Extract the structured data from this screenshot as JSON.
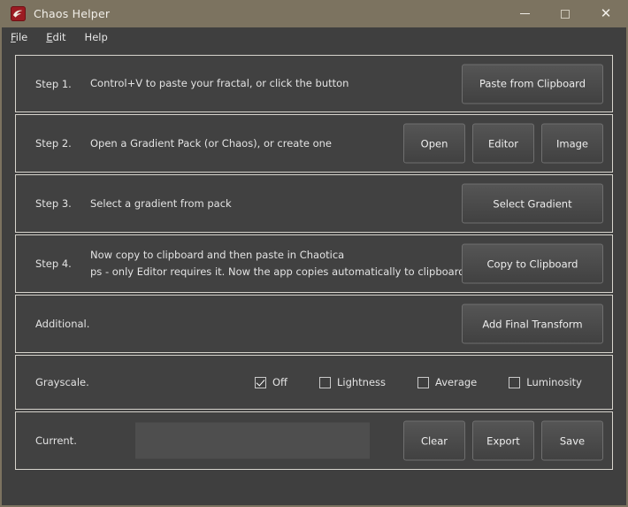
{
  "window": {
    "title": "Chaos Helper",
    "icon": "app-logo-icon",
    "controls": {
      "minimize": "minimize-icon",
      "maximize": "maximize-icon",
      "close": "close-icon"
    }
  },
  "menubar": {
    "items": [
      {
        "label": "File",
        "accel": "F",
        "rest": "ile"
      },
      {
        "label": "Edit",
        "accel": "E",
        "rest": "dit"
      },
      {
        "label": "Help",
        "accel": "H",
        "rest": "elp"
      }
    ]
  },
  "steps": [
    {
      "label": "Step 1.",
      "desc": "Control+V to paste your fractal, or click the button",
      "desc2": "",
      "buttons": [
        "Paste from Clipboard"
      ]
    },
    {
      "label": "Step 2.",
      "desc": "Open a Gradient Pack (or Chaos), or create one",
      "desc2": "",
      "buttons": [
        "Open",
        "Editor",
        "Image"
      ]
    },
    {
      "label": "Step 3.",
      "desc": "Select a gradient from pack",
      "desc2": "",
      "buttons": [
        "Select Gradient"
      ]
    },
    {
      "label": "Step 4.",
      "desc": "Now copy to clipboard and then paste in Chaotica",
      "desc2": "ps - only Editor requires it. Now the app copies automatically to clipboard",
      "buttons": [
        "Copy to Clipboard"
      ]
    },
    {
      "label": "Additional.",
      "desc": "",
      "desc2": "",
      "buttons": [
        "Add Final Transform"
      ]
    }
  ],
  "grayscale": {
    "label": "Grayscale.",
    "options": [
      {
        "label": "Off",
        "checked": true
      },
      {
        "label": "Lightness",
        "checked": false
      },
      {
        "label": "Average",
        "checked": false
      },
      {
        "label": "Luminosity",
        "checked": false
      }
    ]
  },
  "current": {
    "label": "Current.",
    "value": "",
    "placeholder": "",
    "buttons": [
      "Clear",
      "Export",
      "Save"
    ]
  },
  "colors": {
    "titlebar": "#7c7360",
    "background": "#3f3f3f",
    "panel": "#414141",
    "panel_border": "#d7d4cd",
    "button_top": "#555555",
    "button_bottom": "#414141",
    "text": "#e3e3e3",
    "input": "#4e4e4e",
    "icon_red": "#9b1b22"
  }
}
